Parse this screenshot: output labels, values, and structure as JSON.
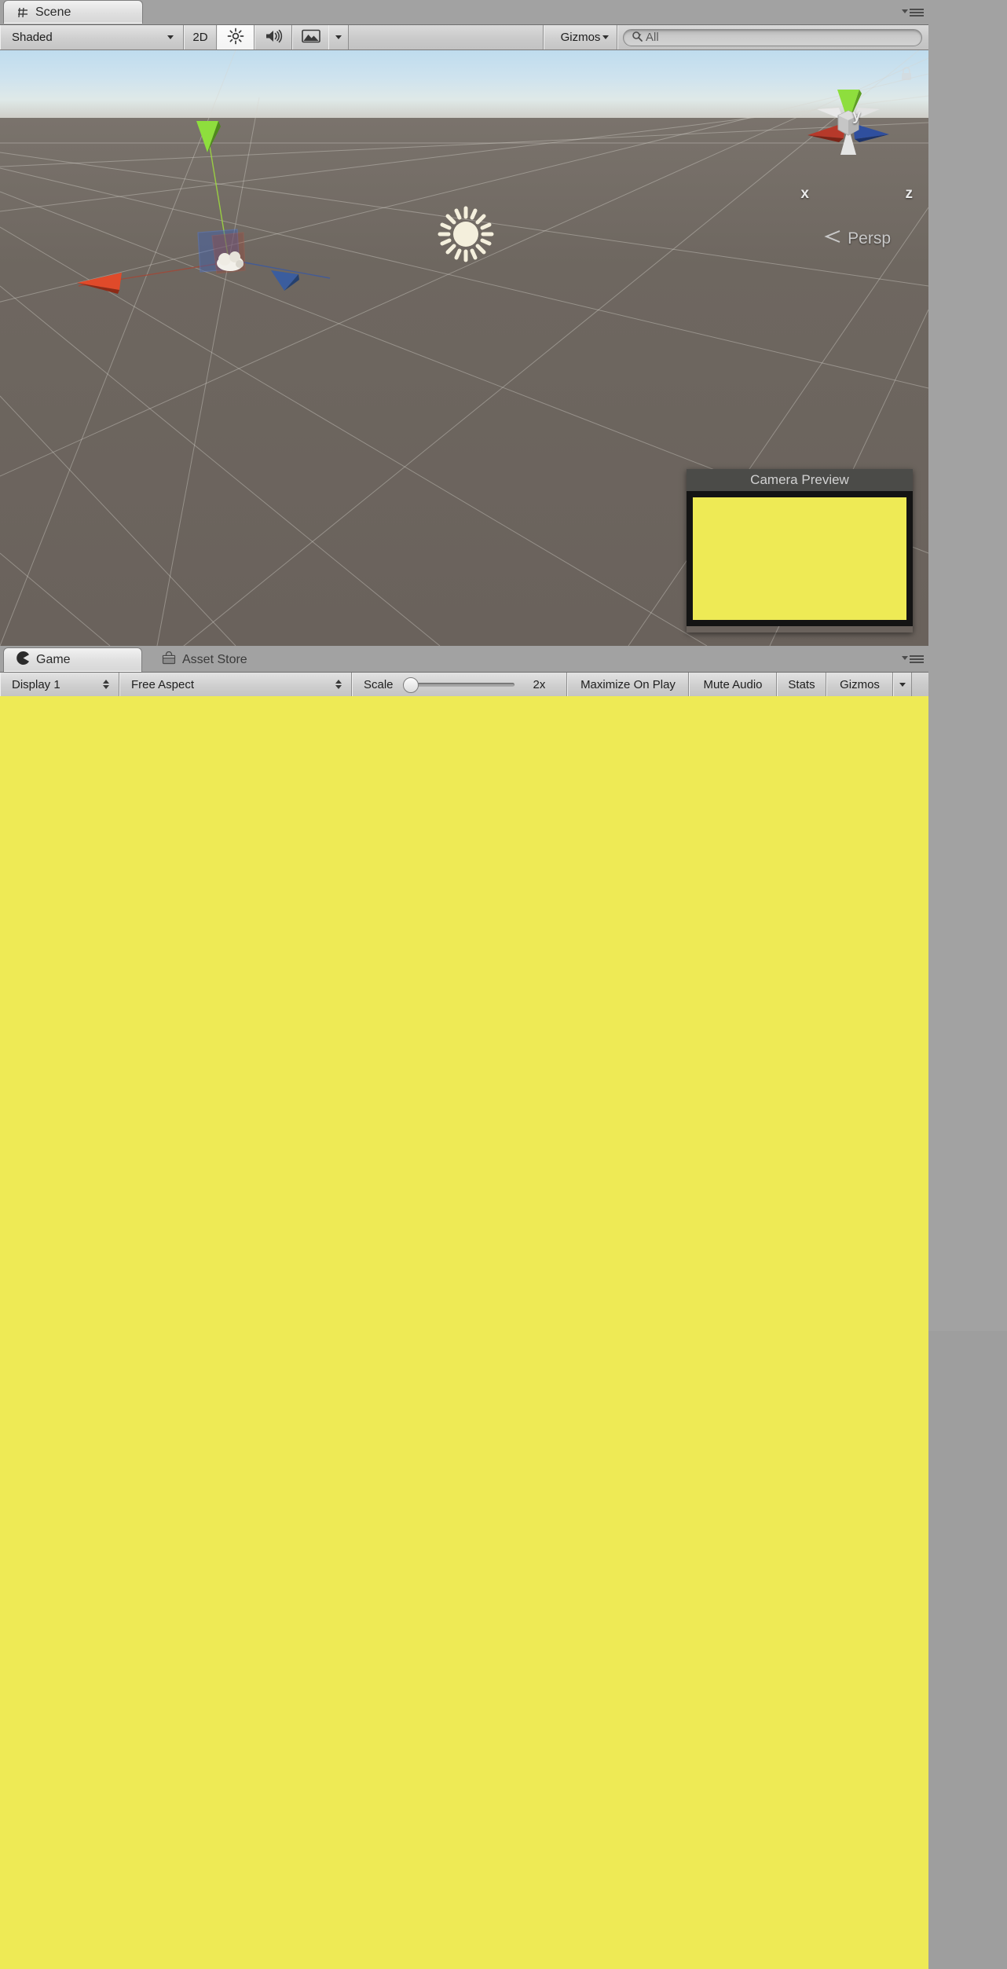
{
  "window": {
    "bg_color": "#a2a2a2"
  },
  "scene_panel": {
    "tabs": [
      {
        "label": "Scene",
        "icon": "grid-icon",
        "active": true
      }
    ],
    "panel_menu_icon": "panel-menu-icon",
    "toolbar": {
      "draw_mode": {
        "label": "Shaded",
        "icon": "chevron-down-icon"
      },
      "two_d_button": {
        "label": "2D"
      },
      "lighting_button": {
        "icon": "sun-light-icon",
        "active": true
      },
      "audio_button": {
        "icon": "speaker-icon",
        "active": false
      },
      "effects_button": {
        "icon": "image-effects-icon",
        "active": false
      },
      "effects_dropdown": {
        "icon": "chevron-down-icon"
      },
      "gizmos_button": {
        "label": "Gizmos",
        "icon": "chevron-down-icon"
      },
      "search": {
        "placeholder": "All",
        "value": "",
        "icon": "search-icon"
      }
    },
    "viewport": {
      "axis_labels": {
        "x": "x",
        "y": "y",
        "z": "z"
      },
      "projection_label": "Persp",
      "projection_icon": "perspective-icon",
      "lock_icon": "lock-icon",
      "gizmo_colors": {
        "x": "#b0392a",
        "y": "#8ccf3f",
        "z": "#2f4f9e",
        "center": "#c9c9c9"
      },
      "sky_top_color": "#bfdcee",
      "ground_color": "#6d645e",
      "objects": [
        {
          "name": "directional-light-gizmo",
          "icon": "sun-gizmo-icon"
        },
        {
          "name": "camera-frustum-gizmo"
        },
        {
          "name": "move-tool-handles"
        }
      ]
    },
    "camera_preview": {
      "title": "Camera Preview",
      "screen_color": "#eeea55"
    }
  },
  "game_panel": {
    "tabs": [
      {
        "label": "Game",
        "icon": "game-icon",
        "active": true
      },
      {
        "label": "Asset Store",
        "icon": "asset-store-icon",
        "active": false
      }
    ],
    "panel_menu_icon": "panel-menu-icon",
    "toolbar": {
      "display": {
        "label": "Display 1",
        "icon": "updown-arrows-icon"
      },
      "aspect": {
        "label": "Free Aspect",
        "icon": "updown-arrows-icon"
      },
      "scale": {
        "label": "Scale",
        "value": "2x",
        "percent": 0
      },
      "maximize_on_play": {
        "label": "Maximize On Play",
        "active": false
      },
      "mute_audio": {
        "label": "Mute Audio",
        "active": false
      },
      "stats": {
        "label": "Stats",
        "active": false
      },
      "gizmos": {
        "label": "Gizmos",
        "icon": "chevron-down-icon"
      }
    },
    "viewport": {
      "background_color": "#eeea55"
    }
  }
}
